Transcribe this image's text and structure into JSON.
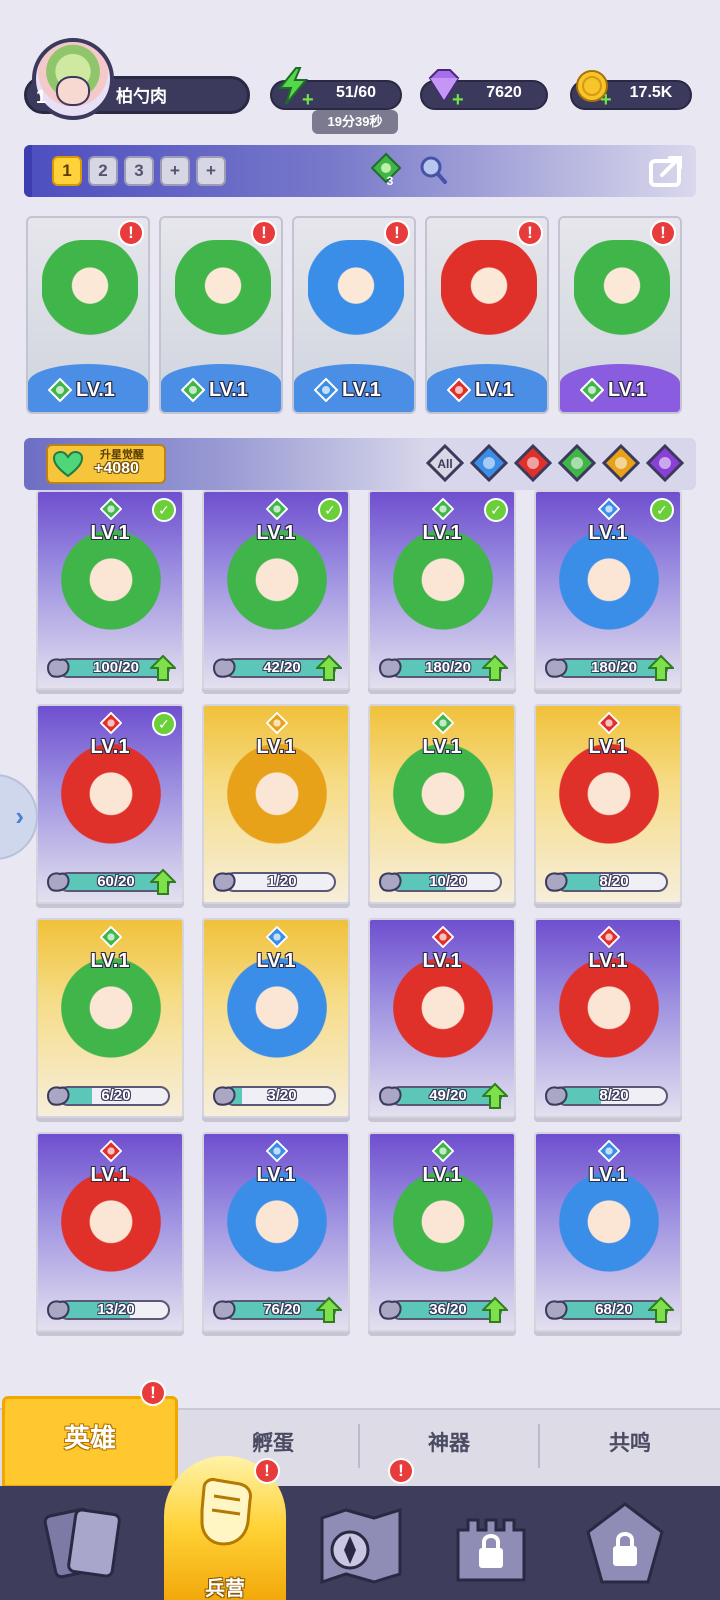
{
  "player": {
    "level": "1",
    "name": "柏勺肉"
  },
  "resources": {
    "energy": "51/60",
    "energy_timer": "19分39秒",
    "gems": "7620",
    "gold": "17.5K"
  },
  "team_tabs": [
    "1",
    "2",
    "3",
    "+",
    "+"
  ],
  "team_bar": {
    "element_count": "3"
  },
  "team_slots": [
    {
      "level": "LV.1",
      "element": "wind",
      "alert": "!",
      "theme": "blue"
    },
    {
      "level": "LV.1",
      "element": "wind",
      "alert": "!",
      "theme": "blue"
    },
    {
      "level": "LV.1",
      "element": "water",
      "alert": "!",
      "theme": "blue"
    },
    {
      "level": "LV.1",
      "element": "fire",
      "alert": "!",
      "theme": "blue"
    },
    {
      "level": "LV.1",
      "element": "wind",
      "alert": "!",
      "theme": "purple"
    }
  ],
  "awaken": {
    "label": "升星觉醒",
    "value": "+4080"
  },
  "filters": [
    "All",
    "water",
    "fire",
    "wind",
    "light",
    "dark"
  ],
  "heroes": [
    {
      "level": "LV.1",
      "element": "wind",
      "checked": true,
      "progress": "100/20",
      "fill": 1.0,
      "theme": "purple"
    },
    {
      "level": "LV.1",
      "element": "wind",
      "checked": true,
      "progress": "42/20",
      "fill": 1.0,
      "theme": "purple"
    },
    {
      "level": "LV.1",
      "element": "wind",
      "checked": true,
      "progress": "180/20",
      "fill": 1.0,
      "theme": "purple"
    },
    {
      "level": "LV.1",
      "element": "water",
      "checked": true,
      "progress": "180/20",
      "fill": 1.0,
      "theme": "purple"
    },
    {
      "level": "LV.1",
      "element": "fire",
      "checked": true,
      "progress": "60/20",
      "fill": 1.0,
      "theme": "purple"
    },
    {
      "level": "LV.1",
      "element": "light",
      "checked": false,
      "progress": "1/20",
      "fill": 0.05,
      "theme": "gold"
    },
    {
      "level": "LV.1",
      "element": "wind",
      "checked": false,
      "progress": "10/20",
      "fill": 0.5,
      "theme": "gold"
    },
    {
      "level": "LV.1",
      "element": "fire",
      "checked": false,
      "progress": "8/20",
      "fill": 0.4,
      "theme": "gold"
    },
    {
      "level": "LV.1",
      "element": "wind",
      "checked": false,
      "progress": "6/20",
      "fill": 0.3,
      "theme": "gold"
    },
    {
      "level": "LV.1",
      "element": "water",
      "checked": false,
      "progress": "3/20",
      "fill": 0.15,
      "theme": "gold"
    },
    {
      "level": "LV.1",
      "element": "fire",
      "checked": false,
      "progress": "49/20",
      "fill": 1.0,
      "theme": "purple"
    },
    {
      "level": "LV.1",
      "element": "fire",
      "checked": false,
      "progress": "8/20",
      "fill": 0.4,
      "theme": "purple"
    },
    {
      "level": "LV.1",
      "element": "fire",
      "checked": false,
      "progress": "13/20",
      "fill": 0.65,
      "theme": "purple"
    },
    {
      "level": "LV.1",
      "element": "water",
      "checked": false,
      "progress": "76/20",
      "fill": 1.0,
      "theme": "purple"
    },
    {
      "level": "LV.1",
      "element": "wind",
      "checked": false,
      "progress": "36/20",
      "fill": 1.0,
      "theme": "purple"
    },
    {
      "level": "LV.1",
      "element": "water",
      "checked": false,
      "progress": "68/20",
      "fill": 1.0,
      "theme": "purple"
    }
  ],
  "sub_tabs": {
    "heroes": "英雄",
    "hatch": "孵蛋",
    "artifact": "神器",
    "resonance": "共鸣",
    "heroes_alert": "!"
  },
  "nav": {
    "barracks": "兵营",
    "barracks_alert": "!",
    "map_alert": "!"
  },
  "colors": {
    "wind": "#3fb54a",
    "water": "#3a8ee8",
    "fire": "#e0302a",
    "light": "#e7a21a",
    "dark": "#8b3fd6",
    "accent_gold": "#ffc82e",
    "nav_bg": "#3f3d5c"
  }
}
